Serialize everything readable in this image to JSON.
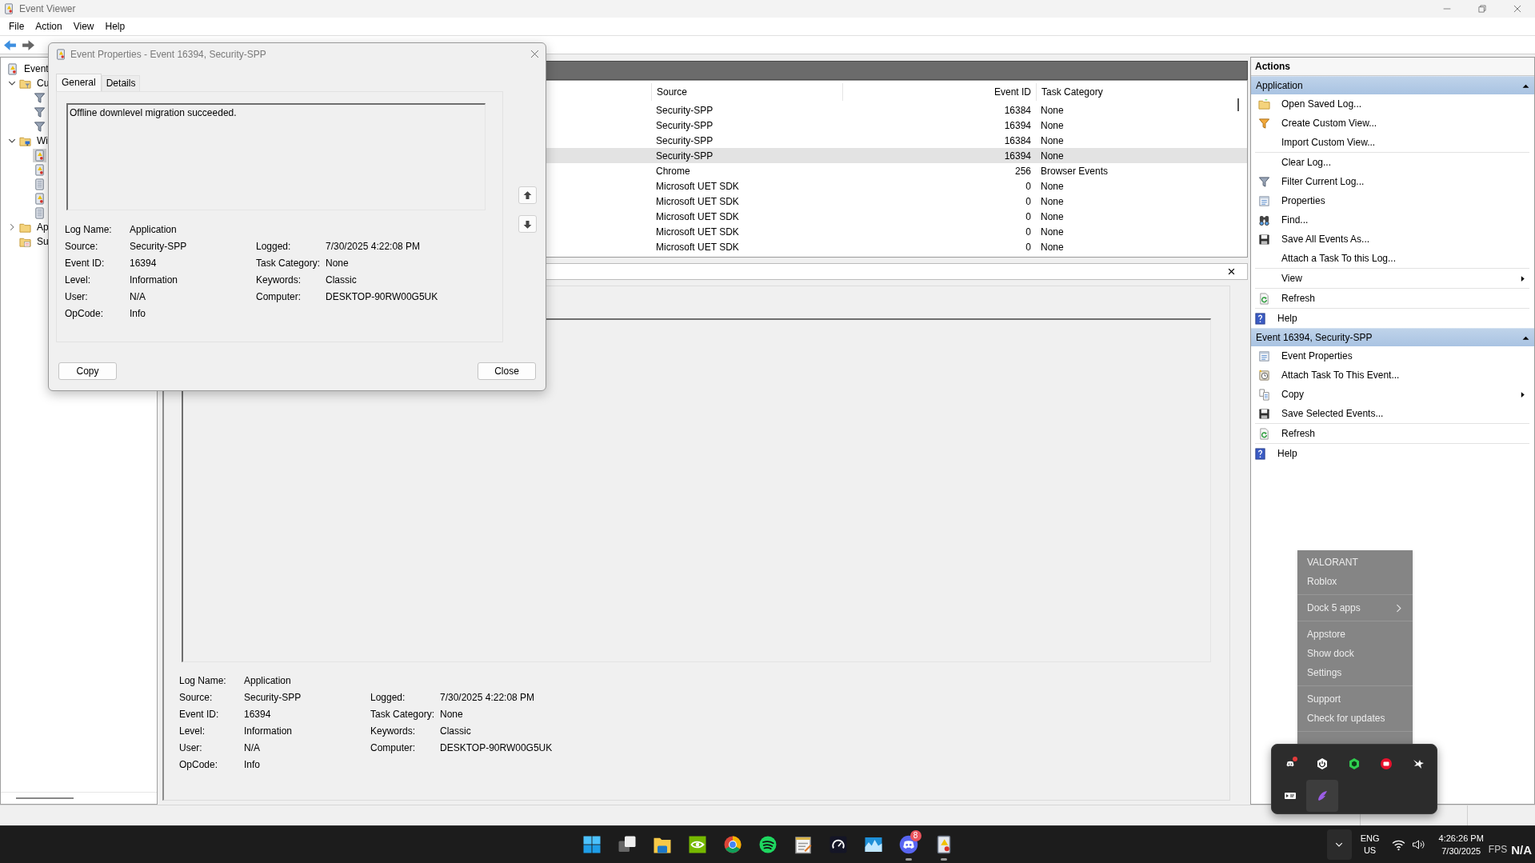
{
  "window": {
    "title": "Event Viewer",
    "menu": [
      "File",
      "Action",
      "View",
      "Help"
    ]
  },
  "navigation_tree": [
    {
      "label": "Event",
      "kind": "log",
      "children": [
        {
          "label": "Cu",
          "kind": "folder-filter",
          "expanded": true,
          "children": [
            {
              "kind": "filter"
            },
            {
              "kind": "filter"
            },
            {
              "kind": "filter"
            }
          ]
        },
        {
          "label": "Wi",
          "kind": "folder-pc",
          "expanded": true,
          "children": [
            {
              "kind": "log",
              "selected": true
            },
            {
              "kind": "log",
              "selected": false
            },
            {
              "kind": "log-plain",
              "selected": false
            },
            {
              "kind": "log",
              "selected": false
            },
            {
              "kind": "log-plain",
              "selected": false
            }
          ]
        },
        {
          "label": "Ap",
          "kind": "folder",
          "expanded": false
        },
        {
          "label": "Su",
          "kind": "subscriptions"
        }
      ]
    }
  ],
  "event_list": {
    "columns": [
      {
        "label": "Source"
      },
      {
        "label": "Event ID"
      },
      {
        "label": "Task Category"
      }
    ],
    "rows": [
      {
        "source": "Security-SPP",
        "event_id": "16384",
        "task_category": "None",
        "selected": false
      },
      {
        "source": "Security-SPP",
        "event_id": "16394",
        "task_category": "None",
        "selected": false
      },
      {
        "source": "Security-SPP",
        "event_id": "16384",
        "task_category": "None",
        "selected": false
      },
      {
        "source": "Security-SPP",
        "event_id": "16394",
        "task_category": "None",
        "selected": true
      },
      {
        "source": "Chrome",
        "event_id": "256",
        "task_category": "Browser Events",
        "selected": false
      },
      {
        "source": "Microsoft UET SDK",
        "event_id": "0",
        "task_category": "None",
        "selected": false
      },
      {
        "source": "Microsoft UET SDK",
        "event_id": "0",
        "task_category": "None",
        "selected": false
      },
      {
        "source": "Microsoft UET SDK",
        "event_id": "0",
        "task_category": "None",
        "selected": false
      },
      {
        "source": "Microsoft UET SDK",
        "event_id": "0",
        "task_category": "None",
        "selected": false
      },
      {
        "source": "Microsoft UET SDK",
        "event_id": "0",
        "task_category": "None",
        "selected": false
      }
    ]
  },
  "preview": {
    "left_fields": [
      {
        "label": "Log Name:",
        "value": "Application"
      },
      {
        "label": "Source:",
        "value": "Security-SPP"
      },
      {
        "label": "Event ID:",
        "value": "16394"
      },
      {
        "label": "Level:",
        "value": "Information"
      },
      {
        "label": "User:",
        "value": "N/A"
      },
      {
        "label": "OpCode:",
        "value": "Info"
      }
    ],
    "right_fields": [
      {
        "label": "Logged:",
        "value": "7/30/2025 4:22:08 PM"
      },
      {
        "label": "Task Category:",
        "value": "None"
      },
      {
        "label": "Keywords:",
        "value": "Classic"
      },
      {
        "label": "Computer:",
        "value": "DESKTOP-90RW00G5UK"
      }
    ]
  },
  "dialog": {
    "title": "Event Properties - Event 16394, Security-SPP",
    "tabs": [
      {
        "label": "General",
        "selected": true
      },
      {
        "label": "Details",
        "selected": false
      }
    ],
    "message": "Offline downlevel migration succeeded.",
    "left_fields": [
      {
        "label": "Log Name:",
        "value": "Application"
      },
      {
        "label": "Source:",
        "value": "Security-SPP"
      },
      {
        "label": "Event ID:",
        "value": "16394"
      },
      {
        "label": "Level:",
        "value": "Information"
      },
      {
        "label": "User:",
        "value": "N/A"
      },
      {
        "label": "OpCode:",
        "value": "Info"
      }
    ],
    "right_fields": [
      {
        "label": "Logged:",
        "value": "7/30/2025 4:22:08 PM"
      },
      {
        "label": "Task Category:",
        "value": "None"
      },
      {
        "label": "Keywords:",
        "value": "Classic"
      },
      {
        "label": "Computer:",
        "value": "DESKTOP-90RW00G5UK"
      }
    ],
    "buttons": [
      "Copy",
      "Close"
    ]
  },
  "actions": {
    "title": "Actions",
    "groups": [
      {
        "title": "Application",
        "expanded": true,
        "sections": [
          [
            {
              "label": "Open Saved Log...",
              "kind": "open",
              "submenu": false
            },
            {
              "label": "Create Custom View...",
              "kind": "create-view",
              "submenu": false
            },
            {
              "label": "Import Custom View...",
              "kind": "plain",
              "submenu": false
            }
          ],
          [
            {
              "label": "Clear Log...",
              "kind": "plain",
              "submenu": false
            },
            {
              "label": "Filter Current Log...",
              "kind": "filter",
              "submenu": false
            },
            {
              "label": "Properties",
              "kind": "properties",
              "submenu": false
            },
            {
              "label": "Find...",
              "kind": "find",
              "submenu": false
            },
            {
              "label": "Save All Events As...",
              "kind": "save",
              "submenu": false
            },
            {
              "label": "Attach a Task To this Log...",
              "kind": "plain",
              "submenu": false
            }
          ],
          [
            {
              "label": "View",
              "kind": "plain",
              "submenu": true
            }
          ],
          [
            {
              "label": "Refresh",
              "kind": "refresh",
              "submenu": false
            }
          ],
          [
            {
              "label": "Help",
              "kind": "help",
              "submenu": false
            }
          ]
        ]
      },
      {
        "title": "Event 16394, Security-SPP",
        "expanded": true,
        "sections": [
          [
            {
              "label": "Event Properties",
              "kind": "properties",
              "submenu": false
            },
            {
              "label": "Attach Task To This Event...",
              "kind": "attach-task",
              "submenu": false
            },
            {
              "label": "Copy",
              "kind": "copy",
              "submenu": true
            },
            {
              "label": "Save Selected Events...",
              "kind": "save",
              "submenu": false
            }
          ],
          [
            {
              "label": "Refresh",
              "kind": "refresh",
              "submenu": false
            }
          ],
          [
            {
              "label": "Help",
              "kind": "help",
              "submenu": false
            }
          ]
        ]
      }
    ]
  },
  "context_menu": {
    "sections": [
      [
        {
          "label": "VALORANT",
          "submenu": false
        },
        {
          "label": "Roblox",
          "submenu": false
        }
      ],
      [
        {
          "label": "Dock 5 apps",
          "submenu": true
        }
      ],
      [
        {
          "label": "Appstore",
          "submenu": false
        },
        {
          "label": "Show dock",
          "submenu": false
        },
        {
          "label": "Settings",
          "submenu": false
        }
      ],
      [
        {
          "label": "Support",
          "submenu": false
        },
        {
          "label": "Check for updates",
          "submenu": false
        }
      ]
    ]
  },
  "tray_popup": {
    "icons": [
      {
        "kind": "gamepad",
        "notification": true,
        "selected": false
      },
      {
        "kind": "power",
        "notification": false,
        "selected": false
      },
      {
        "kind": "hexagon",
        "notification": false,
        "selected": false
      },
      {
        "kind": "red-circle",
        "notification": false,
        "selected": false
      },
      {
        "kind": "bird",
        "notification": false,
        "selected": false
      },
      {
        "kind": "card",
        "notification": false,
        "selected": false
      },
      {
        "kind": "feather",
        "notification": false,
        "selected": true
      }
    ]
  },
  "taskbar": {
    "apps": [
      {
        "kind": "start",
        "running": false
      },
      {
        "kind": "task-view",
        "running": false
      },
      {
        "kind": "explorer",
        "running": false
      },
      {
        "kind": "nvidia",
        "running": false
      },
      {
        "kind": "chrome",
        "running": false
      },
      {
        "kind": "spotify",
        "running": false
      },
      {
        "kind": "notepad",
        "running": false
      },
      {
        "kind": "speedtest",
        "running": false
      },
      {
        "kind": "photos",
        "running": false
      },
      {
        "kind": "discord",
        "running": true,
        "badge": "8"
      },
      {
        "kind": "event-viewer",
        "running": true
      }
    ],
    "language": {
      "line_1": "ENG",
      "line_2": "US"
    },
    "clock": {
      "time": "4:26:26 PM",
      "date": "7/30/2025"
    },
    "overlay": {
      "label": "FPS",
      "value": "N/A"
    }
  }
}
